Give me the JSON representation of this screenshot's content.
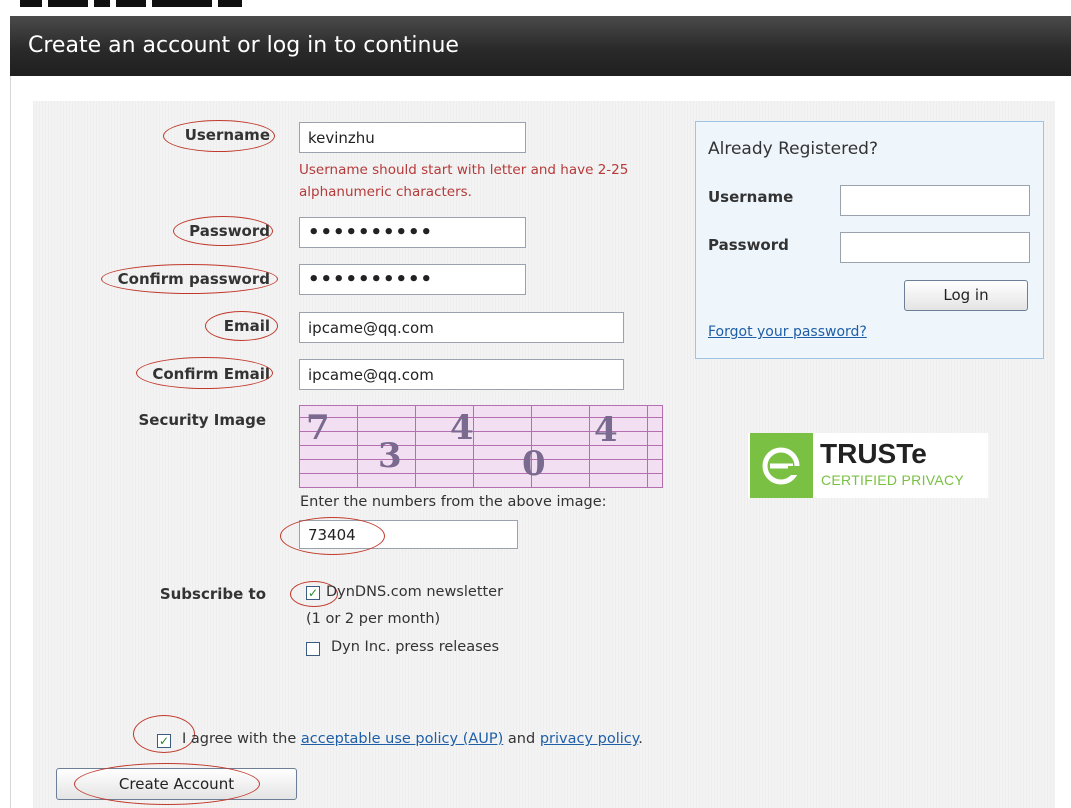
{
  "title": "Create an account or log in to continue",
  "form": {
    "username_label": "Username",
    "username_value": "kevinzhu",
    "username_error": "Username should start with letter and have 2-25 alphanumeric characters.",
    "password_label": "Password",
    "password_value": "••••••••••",
    "confirm_password_label": "Confirm password",
    "confirm_password_value": "••••••••••",
    "email_label": "Email",
    "email_value": "ipcame@qq.com",
    "confirm_email_label": "Confirm Email",
    "confirm_email_value": "ipcame@qq.com",
    "security_image_label": "Security Image",
    "captcha_digits": [
      "7",
      "3",
      "4",
      "0",
      "4"
    ],
    "captcha_prompt": "Enter the numbers from the above image:",
    "captcha_value": "73404",
    "subscribe_label": "Subscribe to",
    "newsletter_label": "DynDNS.com newsletter",
    "newsletter_note": "(1 or 2 per month)",
    "newsletter_checked": true,
    "press_label": "Dyn Inc. press releases",
    "press_checked": false,
    "agree_checked": true,
    "agree_prefix": "I agree with the",
    "aup_link": "acceptable use policy (AUP)",
    "agree_and": "and",
    "privacy_link": "privacy policy",
    "agree_suffix": ".",
    "create_button": "Create Account"
  },
  "login": {
    "heading": "Already Registered?",
    "username_label": "Username",
    "password_label": "Password",
    "login_button": "Log in",
    "forgot_link": "Forgot your password?"
  },
  "truste": {
    "name": "TRUSTe",
    "tagline": "CERTIFIED PRIVACY"
  },
  "colors": {
    "annotation": "#c0392b",
    "error": "#b53a3a",
    "link": "#1f5fa8",
    "truste_green": "#7ac143"
  },
  "icons": {
    "checkmark": "check-icon",
    "truste_logo": "truste-logo"
  }
}
